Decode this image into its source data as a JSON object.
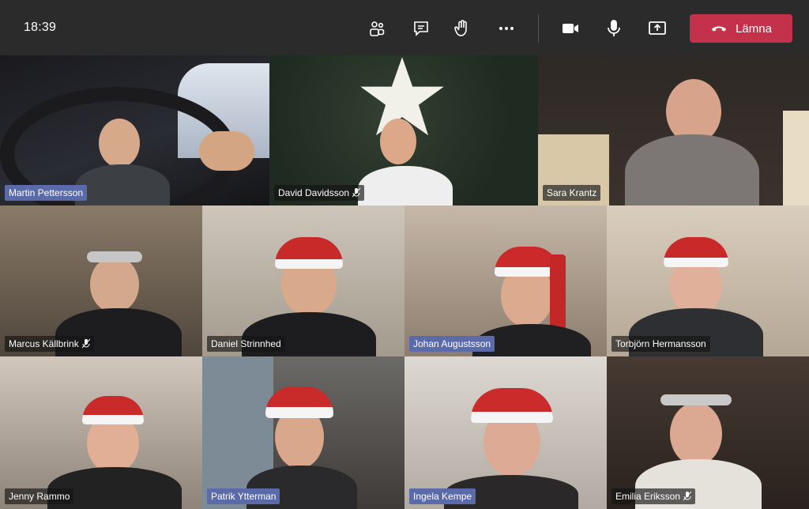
{
  "app": {
    "time": "18:39",
    "controls": {
      "participants_icon": "people-icon",
      "chat_icon": "chat-icon",
      "raise_hand_icon": "hand-icon",
      "more_icon": "more-icon",
      "camera_icon": "camera-icon",
      "mic_icon": "mic-icon",
      "share_icon": "share-icon"
    },
    "leave_label": "Lämna",
    "leave_color": "#c4314b"
  },
  "participants": [
    {
      "name": "Martin Pettersson",
      "muted": false,
      "highlight": true
    },
    {
      "name": "David Davidsson",
      "muted": true,
      "highlight": false
    },
    {
      "name": "Sara Krantz",
      "muted": false,
      "highlight": false
    },
    {
      "name": "Marcus Källbrink",
      "muted": true,
      "highlight": false
    },
    {
      "name": "Daniel Strinnhed",
      "muted": false,
      "highlight": false
    },
    {
      "name": "Johan Augustsson",
      "muted": false,
      "highlight": true
    },
    {
      "name": "Torbjörn Hermansson",
      "muted": false,
      "highlight": false
    },
    {
      "name": "Jenny Rammo",
      "muted": false,
      "highlight": false
    },
    {
      "name": "Patrik  Ytterman",
      "muted": false,
      "highlight": true
    },
    {
      "name": "Ingela Kempe",
      "muted": false,
      "highlight": true
    },
    {
      "name": "Emilia Eriksson",
      "muted": true,
      "highlight": false
    }
  ]
}
